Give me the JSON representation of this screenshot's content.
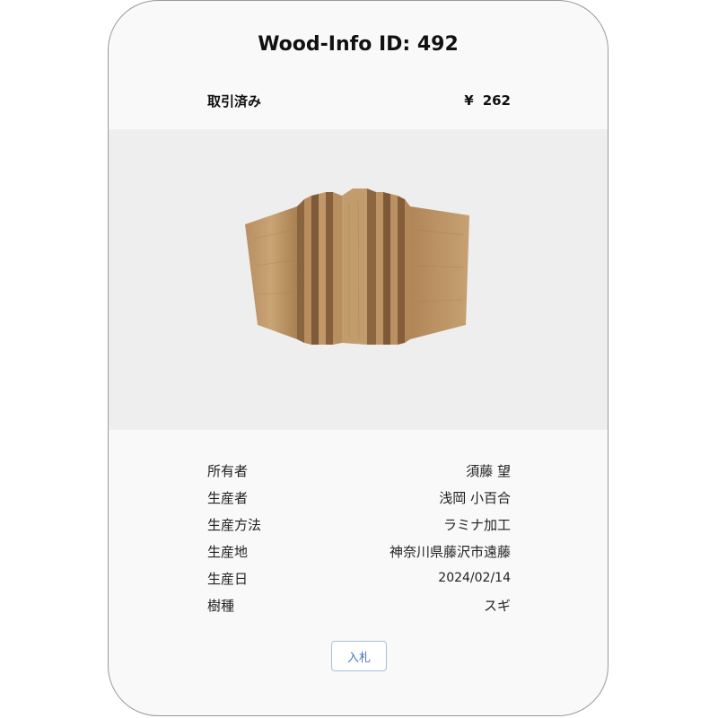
{
  "header": {
    "title": "Wood-Info ID: 492"
  },
  "status": {
    "label": "取引済み",
    "currency": "¥",
    "price": "262"
  },
  "image": {
    "subject": "laminated-wood-block"
  },
  "details": [
    {
      "label": "所有者",
      "value": "須藤 望"
    },
    {
      "label": "生産者",
      "value": "浅岡 小百合"
    },
    {
      "label": "生産方法",
      "value": "ラミナ加工"
    },
    {
      "label": "生産地",
      "value": "神奈川県藤沢市遠藤"
    },
    {
      "label": "生産日",
      "value": "2024/02/14"
    },
    {
      "label": "樹種",
      "value": "スギ"
    }
  ],
  "actions": {
    "bid_label": "入札"
  },
  "colors": {
    "card_background": "#f9f9f9",
    "image_background": "#eeeeee",
    "button_text": "#4a78b8",
    "button_border": "#a8c0de",
    "wood_light": "#c39c6e",
    "wood_dark": "#7a5636"
  }
}
